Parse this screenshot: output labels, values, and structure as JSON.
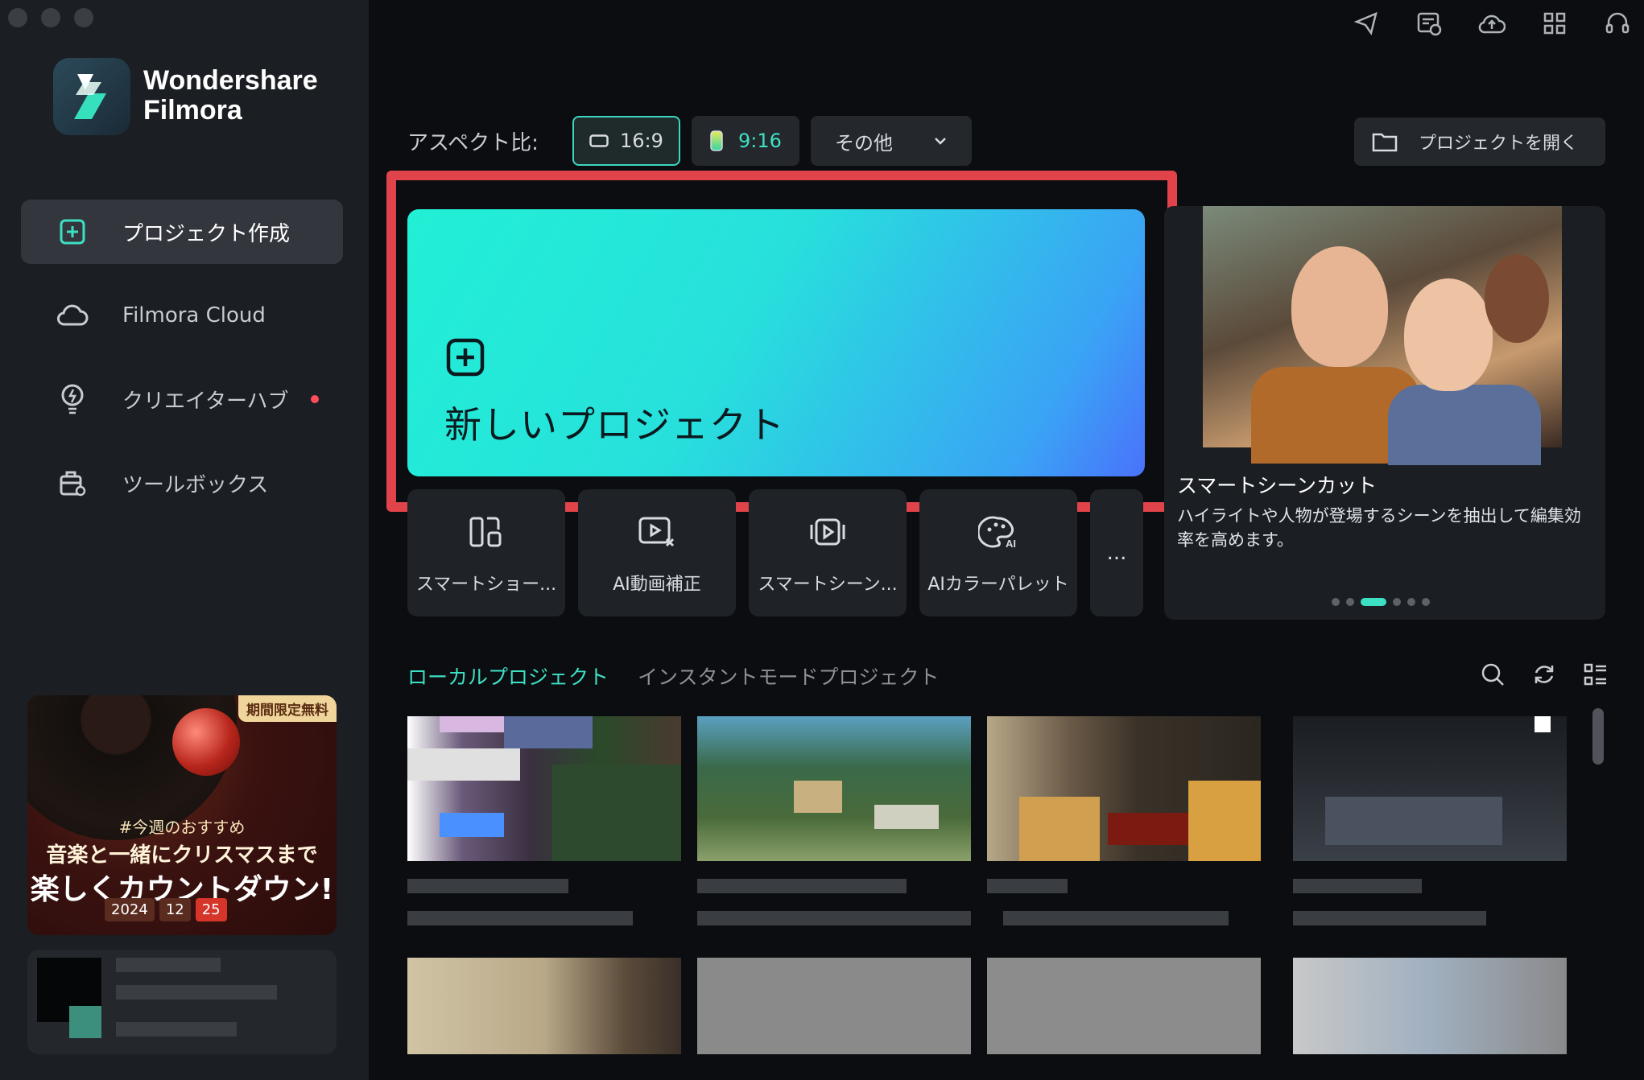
{
  "app": {
    "brand_line1": "Wondershare",
    "brand_line2": "Filmora"
  },
  "sidebar": {
    "items": [
      {
        "label": "プロジェクト作成",
        "icon": "plus-square-icon",
        "active": true
      },
      {
        "label": "Filmora Cloud",
        "icon": "cloud-icon",
        "active": false
      },
      {
        "label": "クリエイターハブ",
        "icon": "bulb-icon",
        "active": false,
        "notification": true
      },
      {
        "label": "ツールボックス",
        "icon": "toolbox-icon",
        "active": false
      }
    ],
    "promo": {
      "badge": "期間限定無料",
      "line1": "#今週のおすすめ",
      "line2": "音楽と一緒にクリスマスまで",
      "line3": "楽しくカウントダウン!",
      "date_year": "2024",
      "date_month": "12",
      "date_day": "25"
    }
  },
  "toolbar_icons": [
    "send-icon",
    "calendar-clock-icon",
    "cloud-upload-icon",
    "grid-apps-icon",
    "headset-icon"
  ],
  "aspect": {
    "label": "アスペクト比:",
    "ratio_wide": "16:9",
    "ratio_tall": "9:16",
    "other": "その他",
    "open_project": "プロジェクトを開く"
  },
  "new_project": {
    "label": "新しいプロジェクト"
  },
  "feature": {
    "title": "スマートシーンカット",
    "description": "ハイライトや人物が登場するシーンを抽出して編集効率を高めます。",
    "pager_count": 6,
    "pager_active": 2
  },
  "tools": [
    {
      "label": "スマートショー...",
      "icon": "smart-short-icon"
    },
    {
      "label": "AI動画補正",
      "icon": "ai-enhance-icon"
    },
    {
      "label": "スマートシーン...",
      "icon": "smart-scene-icon"
    },
    {
      "label": "AIカラーパレット",
      "icon": "ai-palette-icon"
    }
  ],
  "tools_more": "...",
  "tabs": {
    "local": "ローカルプロジェクト",
    "instant": "インスタントモードプロジェクト"
  },
  "colors": {
    "accent": "#3ee0c4",
    "highlight": "#e0434a",
    "notification": "#ff4d5e"
  }
}
